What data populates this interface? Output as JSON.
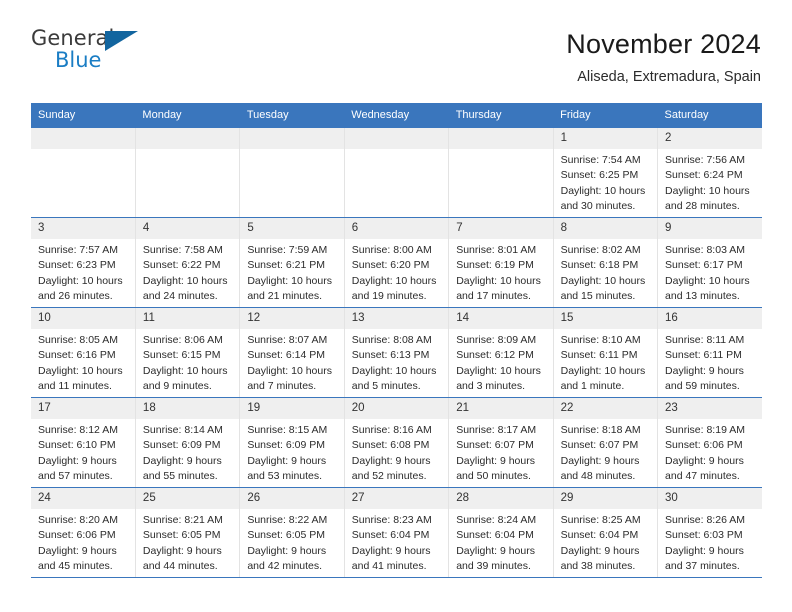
{
  "logo": {
    "word_one": "General",
    "word_two": "Blue",
    "triangle_icon": "triangle-icon",
    "brand_blue": "#1a7dc4",
    "brand_dark": "#3b3b3b"
  },
  "header": {
    "title": "November 2024",
    "subtitle": "Aliseda, Extremadura, Spain"
  },
  "theme": {
    "header_blue": "#3a76bd",
    "daynum_band": "#efefef",
    "text": "#2b2b2b"
  },
  "calendar": {
    "weekdays": [
      "Sunday",
      "Monday",
      "Tuesday",
      "Wednesday",
      "Thursday",
      "Friday",
      "Saturday"
    ],
    "weeks": [
      [
        {
          "day": "",
          "blank": true,
          "sunrise": "",
          "sunset": "",
          "daylight_line1": "",
          "daylight_line2": ""
        },
        {
          "day": "",
          "blank": true,
          "sunrise": "",
          "sunset": "",
          "daylight_line1": "",
          "daylight_line2": ""
        },
        {
          "day": "",
          "blank": true,
          "sunrise": "",
          "sunset": "",
          "daylight_line1": "",
          "daylight_line2": ""
        },
        {
          "day": "",
          "blank": true,
          "sunrise": "",
          "sunset": "",
          "daylight_line1": "",
          "daylight_line2": ""
        },
        {
          "day": "",
          "blank": true,
          "sunrise": "",
          "sunset": "",
          "daylight_line1": "",
          "daylight_line2": ""
        },
        {
          "day": "1",
          "blank": false,
          "sunrise": "Sunrise: 7:54 AM",
          "sunset": "Sunset: 6:25 PM",
          "daylight_line1": "Daylight: 10 hours",
          "daylight_line2": "and 30 minutes."
        },
        {
          "day": "2",
          "blank": false,
          "sunrise": "Sunrise: 7:56 AM",
          "sunset": "Sunset: 6:24 PM",
          "daylight_line1": "Daylight: 10 hours",
          "daylight_line2": "and 28 minutes."
        }
      ],
      [
        {
          "day": "3",
          "blank": false,
          "sunrise": "Sunrise: 7:57 AM",
          "sunset": "Sunset: 6:23 PM",
          "daylight_line1": "Daylight: 10 hours",
          "daylight_line2": "and 26 minutes."
        },
        {
          "day": "4",
          "blank": false,
          "sunrise": "Sunrise: 7:58 AM",
          "sunset": "Sunset: 6:22 PM",
          "daylight_line1": "Daylight: 10 hours",
          "daylight_line2": "and 24 minutes."
        },
        {
          "day": "5",
          "blank": false,
          "sunrise": "Sunrise: 7:59 AM",
          "sunset": "Sunset: 6:21 PM",
          "daylight_line1": "Daylight: 10 hours",
          "daylight_line2": "and 21 minutes."
        },
        {
          "day": "6",
          "blank": false,
          "sunrise": "Sunrise: 8:00 AM",
          "sunset": "Sunset: 6:20 PM",
          "daylight_line1": "Daylight: 10 hours",
          "daylight_line2": "and 19 minutes."
        },
        {
          "day": "7",
          "blank": false,
          "sunrise": "Sunrise: 8:01 AM",
          "sunset": "Sunset: 6:19 PM",
          "daylight_line1": "Daylight: 10 hours",
          "daylight_line2": "and 17 minutes."
        },
        {
          "day": "8",
          "blank": false,
          "sunrise": "Sunrise: 8:02 AM",
          "sunset": "Sunset: 6:18 PM",
          "daylight_line1": "Daylight: 10 hours",
          "daylight_line2": "and 15 minutes."
        },
        {
          "day": "9",
          "blank": false,
          "sunrise": "Sunrise: 8:03 AM",
          "sunset": "Sunset: 6:17 PM",
          "daylight_line1": "Daylight: 10 hours",
          "daylight_line2": "and 13 minutes."
        }
      ],
      [
        {
          "day": "10",
          "blank": false,
          "sunrise": "Sunrise: 8:05 AM",
          "sunset": "Sunset: 6:16 PM",
          "daylight_line1": "Daylight: 10 hours",
          "daylight_line2": "and 11 minutes."
        },
        {
          "day": "11",
          "blank": false,
          "sunrise": "Sunrise: 8:06 AM",
          "sunset": "Sunset: 6:15 PM",
          "daylight_line1": "Daylight: 10 hours",
          "daylight_line2": "and 9 minutes."
        },
        {
          "day": "12",
          "blank": false,
          "sunrise": "Sunrise: 8:07 AM",
          "sunset": "Sunset: 6:14 PM",
          "daylight_line1": "Daylight: 10 hours",
          "daylight_line2": "and 7 minutes."
        },
        {
          "day": "13",
          "blank": false,
          "sunrise": "Sunrise: 8:08 AM",
          "sunset": "Sunset: 6:13 PM",
          "daylight_line1": "Daylight: 10 hours",
          "daylight_line2": "and 5 minutes."
        },
        {
          "day": "14",
          "blank": false,
          "sunrise": "Sunrise: 8:09 AM",
          "sunset": "Sunset: 6:12 PM",
          "daylight_line1": "Daylight: 10 hours",
          "daylight_line2": "and 3 minutes."
        },
        {
          "day": "15",
          "blank": false,
          "sunrise": "Sunrise: 8:10 AM",
          "sunset": "Sunset: 6:11 PM",
          "daylight_line1": "Daylight: 10 hours",
          "daylight_line2": "and 1 minute."
        },
        {
          "day": "16",
          "blank": false,
          "sunrise": "Sunrise: 8:11 AM",
          "sunset": "Sunset: 6:11 PM",
          "daylight_line1": "Daylight: 9 hours",
          "daylight_line2": "and 59 minutes."
        }
      ],
      [
        {
          "day": "17",
          "blank": false,
          "sunrise": "Sunrise: 8:12 AM",
          "sunset": "Sunset: 6:10 PM",
          "daylight_line1": "Daylight: 9 hours",
          "daylight_line2": "and 57 minutes."
        },
        {
          "day": "18",
          "blank": false,
          "sunrise": "Sunrise: 8:14 AM",
          "sunset": "Sunset: 6:09 PM",
          "daylight_line1": "Daylight: 9 hours",
          "daylight_line2": "and 55 minutes."
        },
        {
          "day": "19",
          "blank": false,
          "sunrise": "Sunrise: 8:15 AM",
          "sunset": "Sunset: 6:09 PM",
          "daylight_line1": "Daylight: 9 hours",
          "daylight_line2": "and 53 minutes."
        },
        {
          "day": "20",
          "blank": false,
          "sunrise": "Sunrise: 8:16 AM",
          "sunset": "Sunset: 6:08 PM",
          "daylight_line1": "Daylight: 9 hours",
          "daylight_line2": "and 52 minutes."
        },
        {
          "day": "21",
          "blank": false,
          "sunrise": "Sunrise: 8:17 AM",
          "sunset": "Sunset: 6:07 PM",
          "daylight_line1": "Daylight: 9 hours",
          "daylight_line2": "and 50 minutes."
        },
        {
          "day": "22",
          "blank": false,
          "sunrise": "Sunrise: 8:18 AM",
          "sunset": "Sunset: 6:07 PM",
          "daylight_line1": "Daylight: 9 hours",
          "daylight_line2": "and 48 minutes."
        },
        {
          "day": "23",
          "blank": false,
          "sunrise": "Sunrise: 8:19 AM",
          "sunset": "Sunset: 6:06 PM",
          "daylight_line1": "Daylight: 9 hours",
          "daylight_line2": "and 47 minutes."
        }
      ],
      [
        {
          "day": "24",
          "blank": false,
          "sunrise": "Sunrise: 8:20 AM",
          "sunset": "Sunset: 6:06 PM",
          "daylight_line1": "Daylight: 9 hours",
          "daylight_line2": "and 45 minutes."
        },
        {
          "day": "25",
          "blank": false,
          "sunrise": "Sunrise: 8:21 AM",
          "sunset": "Sunset: 6:05 PM",
          "daylight_line1": "Daylight: 9 hours",
          "daylight_line2": "and 44 minutes."
        },
        {
          "day": "26",
          "blank": false,
          "sunrise": "Sunrise: 8:22 AM",
          "sunset": "Sunset: 6:05 PM",
          "daylight_line1": "Daylight: 9 hours",
          "daylight_line2": "and 42 minutes."
        },
        {
          "day": "27",
          "blank": false,
          "sunrise": "Sunrise: 8:23 AM",
          "sunset": "Sunset: 6:04 PM",
          "daylight_line1": "Daylight: 9 hours",
          "daylight_line2": "and 41 minutes."
        },
        {
          "day": "28",
          "blank": false,
          "sunrise": "Sunrise: 8:24 AM",
          "sunset": "Sunset: 6:04 PM",
          "daylight_line1": "Daylight: 9 hours",
          "daylight_line2": "and 39 minutes."
        },
        {
          "day": "29",
          "blank": false,
          "sunrise": "Sunrise: 8:25 AM",
          "sunset": "Sunset: 6:04 PM",
          "daylight_line1": "Daylight: 9 hours",
          "daylight_line2": "and 38 minutes."
        },
        {
          "day": "30",
          "blank": false,
          "sunrise": "Sunrise: 8:26 AM",
          "sunset": "Sunset: 6:03 PM",
          "daylight_line1": "Daylight: 9 hours",
          "daylight_line2": "and 37 minutes."
        }
      ]
    ]
  }
}
